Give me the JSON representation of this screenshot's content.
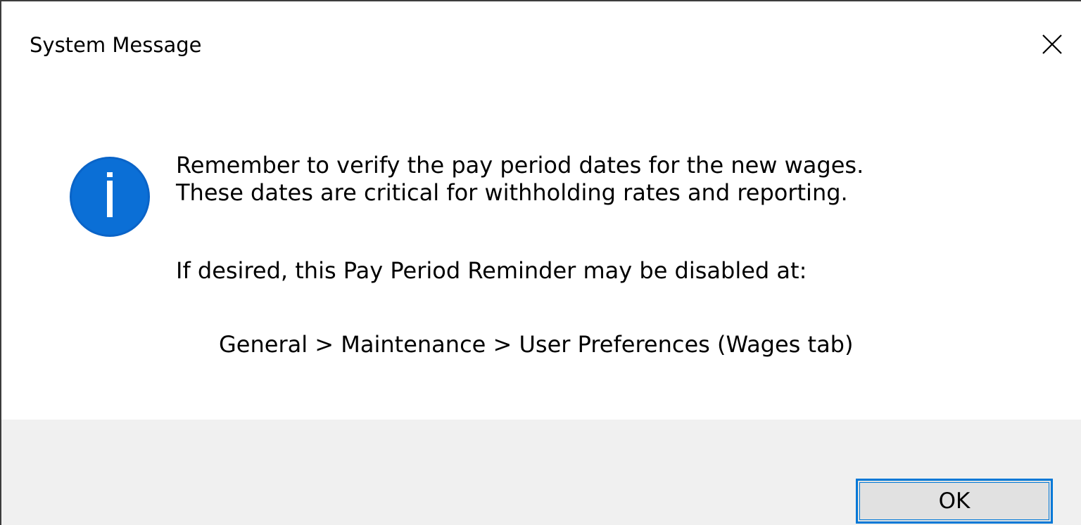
{
  "window": {
    "title": "System Message",
    "close_icon": "close-icon"
  },
  "message": {
    "icon": "info-icon",
    "icon_color": "#0a64c8",
    "line1": "Remember to verify the pay period dates for the new wages.",
    "line2": "These dates are critical for withholding rates and reporting.",
    "line3": "If desired, this Pay Period Reminder may be disabled at:",
    "path": "General > Maintenance > User Preferences (Wages tab)"
  },
  "buttons": {
    "ok_label": "OK",
    "accent": "#0078d7"
  }
}
